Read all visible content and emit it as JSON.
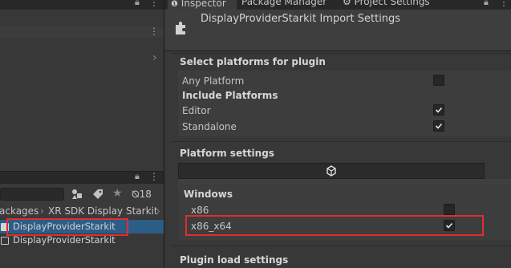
{
  "left_panel": {
    "breadcrumb": [
      "ackages",
      "XR SDK Display Starkit"
    ],
    "hidden_count": "18",
    "tree_items": [
      {
        "label": "DisplayProviderStarkit"
      },
      {
        "label": "DisplayProviderStarkit"
      }
    ]
  },
  "tabs": [
    {
      "label": "Inspector"
    },
    {
      "label": "Package Manager"
    },
    {
      "label": "Project Settings"
    }
  ],
  "inspector": {
    "title": "DisplayProviderStarkit Import Settings",
    "select_platforms": {
      "title": "Select platforms for plugin",
      "any_platform": {
        "label": "Any Platform",
        "checked": false
      },
      "include_title": "Include Platforms",
      "platforms": [
        {
          "label": "Editor",
          "checked": true
        },
        {
          "label": "Standalone",
          "checked": true
        }
      ]
    },
    "platform_settings": {
      "title": "Platform settings",
      "group_title": "Windows",
      "options": [
        {
          "label": "x86",
          "checked": false
        },
        {
          "label": "x86_x64",
          "checked": true
        }
      ]
    },
    "plugin_load_settings": {
      "title": "Plugin load settings"
    }
  },
  "colors": {
    "background": "#383838",
    "selection": "#2c5d87",
    "highlight": "#e22d2d"
  }
}
